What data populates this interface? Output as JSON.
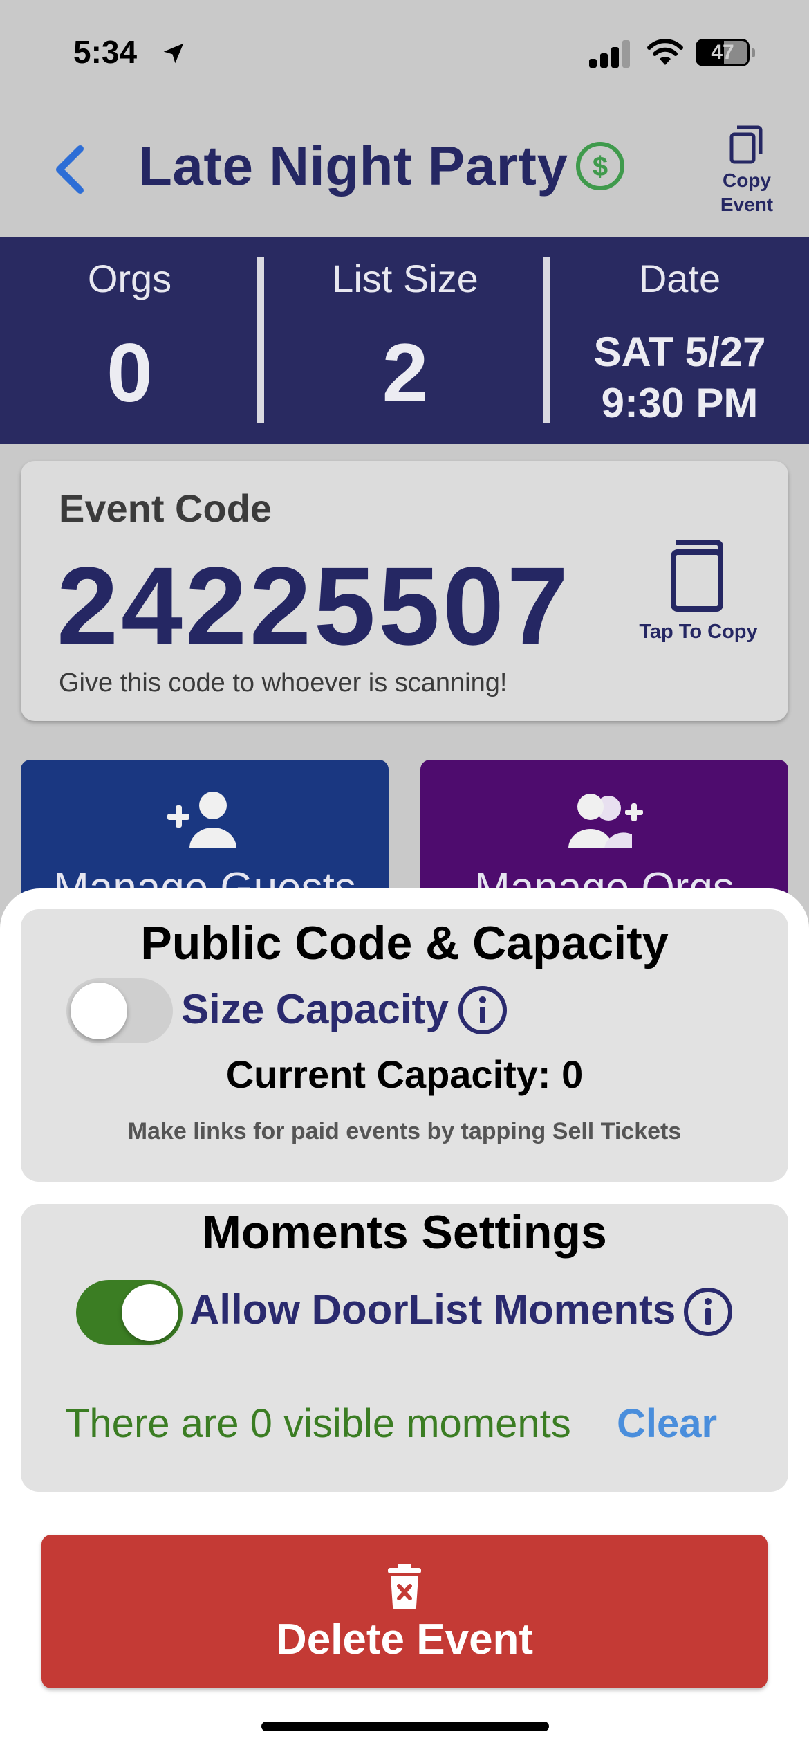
{
  "status_bar": {
    "time": "5:34",
    "battery": "47"
  },
  "header": {
    "title": "Late Night Party",
    "copy_event_label": "Copy Event"
  },
  "stats": {
    "orgs_label": "Orgs",
    "orgs_value": "0",
    "list_size_label": "List Size",
    "list_size_value": "2",
    "date_label": "Date",
    "date_line1": "SAT 5/27",
    "date_line2": "9:30 PM"
  },
  "event_code": {
    "title": "Event Code",
    "code": "24225507",
    "hint": "Give this code to whoever is scanning!",
    "tap_to_copy": "Tap To Copy"
  },
  "manage": {
    "guests_label": "Manage Guests",
    "orgs_label": "Manage Orgs"
  },
  "public_panel": {
    "title": "Public Code & Capacity",
    "toggle_label": "Size Capacity",
    "toggle_on": false,
    "capacity_text": "Current Capacity: 0",
    "hint": "Make links for paid events by tapping Sell Tickets"
  },
  "moments_panel": {
    "title": "Moments Settings",
    "toggle_label": "Allow DoorList Moments",
    "toggle_on": true,
    "visible_text": "There are 0 visible moments",
    "clear_label": "Clear"
  },
  "delete": {
    "label": "Delete Event"
  },
  "colors": {
    "navy": "#292a61",
    "title_navy": "#252763",
    "guests_blue": "#1a3781",
    "orgs_purple": "#4e0c6e",
    "toggle_green": "#3b7d23",
    "clear_blue": "#4a8edc",
    "delete_red": "#c43a35",
    "dollar_green": "#3f9a4c"
  },
  "icons": {
    "back": "chevron-left-icon",
    "dollar": "dollar-circle-icon",
    "copy": "copy-icon",
    "add_person": "person-add-icon",
    "add_group": "group-add-icon",
    "info": "info-circle-icon",
    "trash": "trash-icon"
  }
}
